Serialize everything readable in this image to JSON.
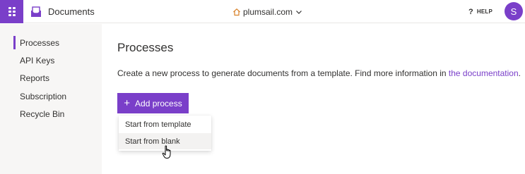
{
  "header": {
    "app_title": "Documents",
    "tenant": "plumsail.com",
    "help_label": "HELP",
    "help_icon": "?",
    "avatar_initial": "S",
    "icons": [
      "app-launcher-icon",
      "documents-icon",
      "home-icon",
      "chevron-down-icon"
    ]
  },
  "sidebar": {
    "items": [
      {
        "label": "Processes",
        "active": true
      },
      {
        "label": "API Keys"
      },
      {
        "label": "Reports"
      },
      {
        "label": "Subscription"
      },
      {
        "label": "Recycle Bin"
      }
    ]
  },
  "main": {
    "title": "Processes",
    "description": "Create a new process to generate documents from a template. Find more information in ",
    "description_link": "the documentation",
    "description_end": ".",
    "add_button": {
      "icon": "+",
      "label": "Add process"
    },
    "dropdown": [
      {
        "label": "Start from template"
      },
      {
        "label": "Start from blank",
        "hovered": true
      }
    ]
  },
  "colors": {
    "accent": "#7a3fc9",
    "sidebar_bg": "#f7f6f5",
    "text": "#323130"
  }
}
